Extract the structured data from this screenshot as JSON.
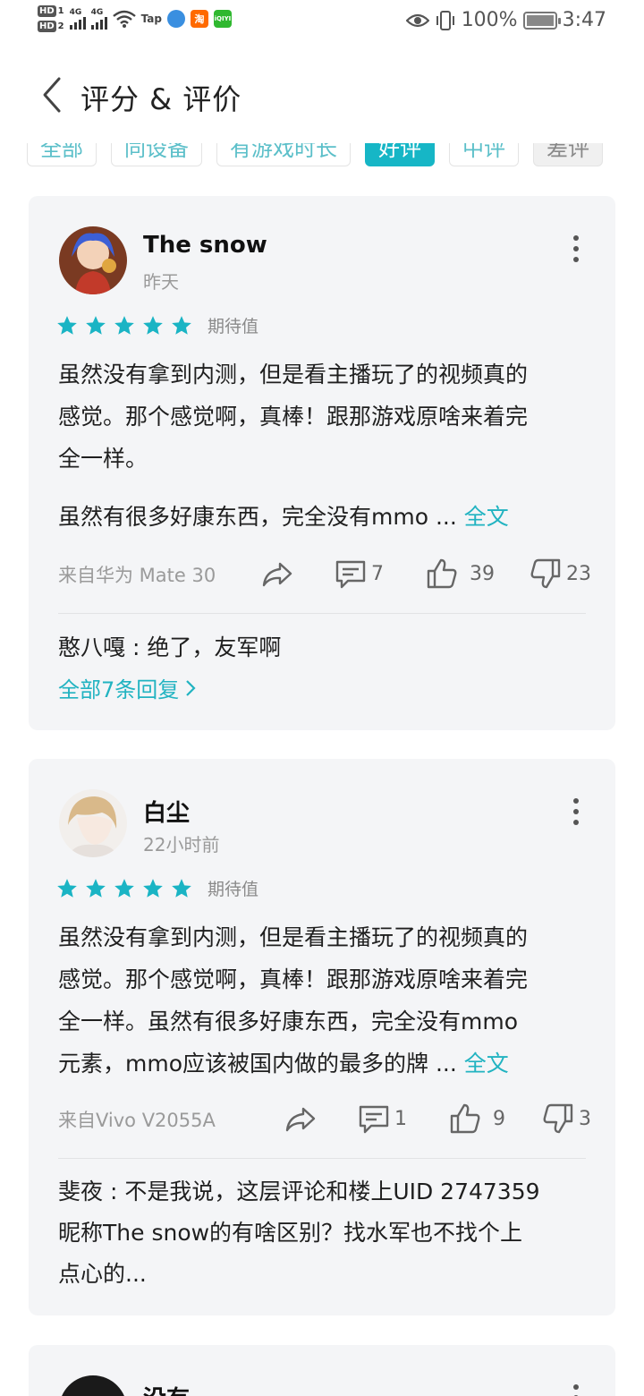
{
  "status_bar": {
    "network_1": "4G",
    "network_2": "4G",
    "app_labels": [
      "Tap",
      "淘",
      "iQIYI"
    ],
    "battery": "100%",
    "time": "3:47"
  },
  "header": {
    "title": "评分 & 评价"
  },
  "filters": [
    {
      "label": "全部",
      "active": false
    },
    {
      "label": "同设备",
      "active": false
    },
    {
      "label": "有游戏时长",
      "active": false
    },
    {
      "label": "好评",
      "active": true
    },
    {
      "label": "中评",
      "active": false
    },
    {
      "label": "差评",
      "active": false
    }
  ],
  "reviews": [
    {
      "user": "The snow",
      "time": "昨天",
      "stars": 5,
      "rating_label": "期待值",
      "body_lines": [
        "虽然没有拿到内测，但是看主播玩了的视频真的",
        "感觉。那个感觉啊，真棒！跟那游戏原啥来着完",
        "全一样。"
      ],
      "body_second_paragraph": "虽然有很多好康东西，完全没有mmo ...",
      "read_more": "全文",
      "device": "来自华为 Mate 30",
      "comments": "7",
      "likes": "39",
      "dislikes": "23",
      "reply": "憨八嘎 : 绝了，友军啊",
      "all_replies": "全部7条回复"
    },
    {
      "user": "白尘",
      "time": "22小时前",
      "stars": 5,
      "rating_label": "期待值",
      "body_lines": [
        "虽然没有拿到内测，但是看主播玩了的视频真的",
        "感觉。那个感觉啊，真棒！跟那游戏原啥来着完",
        "全一样。虽然有很多好康东西，完全没有mmo",
        "元素，mmo应该被国内做的最多的牌 ..."
      ],
      "read_more": "全文",
      "device": "来自Vivo V2055A",
      "comments": "1",
      "likes": "9",
      "dislikes": "3",
      "reply_lines": [
        "斐夜 : 不是我说，这层评论和楼上UID 2747359",
        "昵称The snow的有啥区别？找水军也不找个上",
        "点心的..."
      ]
    },
    {
      "user": "没有"
    }
  ],
  "colors": {
    "accent": "#16b6c6",
    "link": "#21b3c1",
    "card_bg": "#f4f5f7",
    "star": "#1ab4c4"
  }
}
